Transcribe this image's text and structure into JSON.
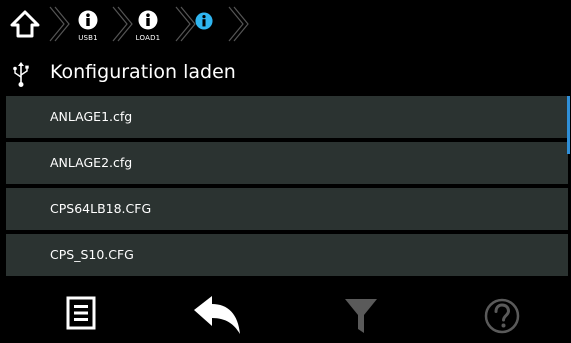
{
  "breadcrumb": {
    "items": [
      {
        "icon": "home-icon",
        "label": ""
      },
      {
        "icon": "info-icon",
        "label": "USB1"
      },
      {
        "icon": "info-icon",
        "label": "LOAD1"
      },
      {
        "icon": "info-icon-active",
        "label": ""
      }
    ]
  },
  "header": {
    "icon": "usb-icon",
    "title": "Konfiguration laden"
  },
  "file_list": {
    "items": [
      {
        "label": "ANLAGE1.cfg"
      },
      {
        "label": "ANLAGE2.cfg"
      },
      {
        "label": "CPS64LB18.CFG"
      },
      {
        "label": "CPS_S10.CFG"
      }
    ]
  },
  "toolbar": {
    "buttons": [
      {
        "icon": "list-icon",
        "enabled": true
      },
      {
        "icon": "back-arrow-icon",
        "enabled": true
      },
      {
        "icon": "filter-icon",
        "enabled": false
      },
      {
        "icon": "help-icon",
        "enabled": false
      }
    ]
  },
  "colors": {
    "background": "#000000",
    "list_item": "#2b3331",
    "accent": "#2f8fd8",
    "disabled_icon": "#5a5a5a"
  }
}
